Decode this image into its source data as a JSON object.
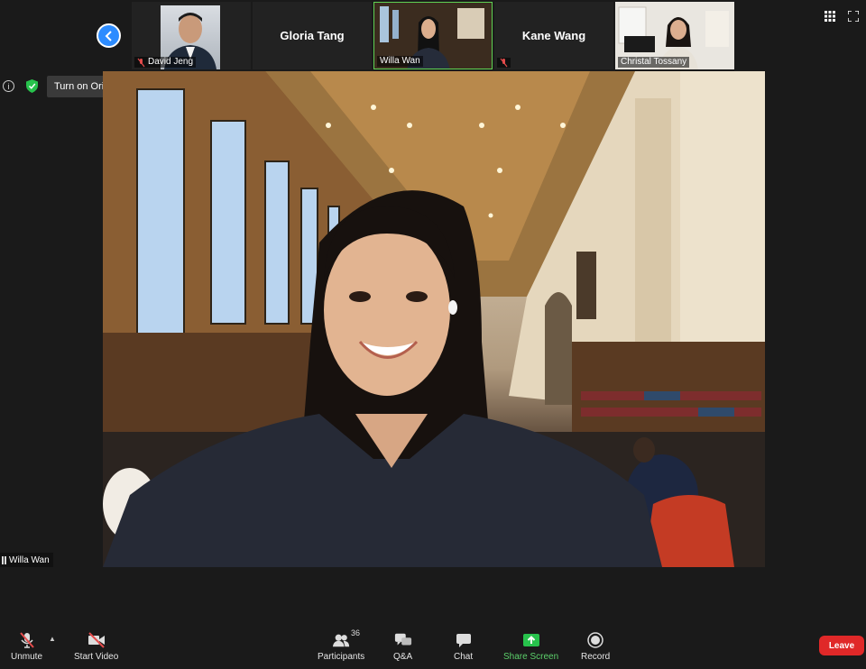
{
  "strip": {
    "participants": [
      {
        "name": "David Jeng",
        "muted": true,
        "video": true
      },
      {
        "name": "Gloria Tang",
        "muted": false,
        "video": false
      },
      {
        "name": "Willa Wan",
        "muted": false,
        "video": true,
        "active": true
      },
      {
        "name": "Kane Wang",
        "muted": true,
        "video": false
      },
      {
        "name": "Christal Tossany",
        "muted": false,
        "video": true
      }
    ]
  },
  "audio_bar": {
    "original_sound_label": "Turn on Original Sound"
  },
  "main": {
    "speaker_name": "Willa Wan"
  },
  "toolbar": {
    "unmute_label": "Unmute",
    "start_video_label": "Start Video",
    "participants_label": "Participants",
    "participants_count": "36",
    "qa_label": "Q&A",
    "chat_label": "Chat",
    "share_label": "Share Screen",
    "record_label": "Record",
    "leave_label": "Leave"
  },
  "colors": {
    "accent_blue": "#2d8cff",
    "share_green": "#5cd06b",
    "active_border": "#5fd253",
    "leave_red": "#e02828"
  }
}
